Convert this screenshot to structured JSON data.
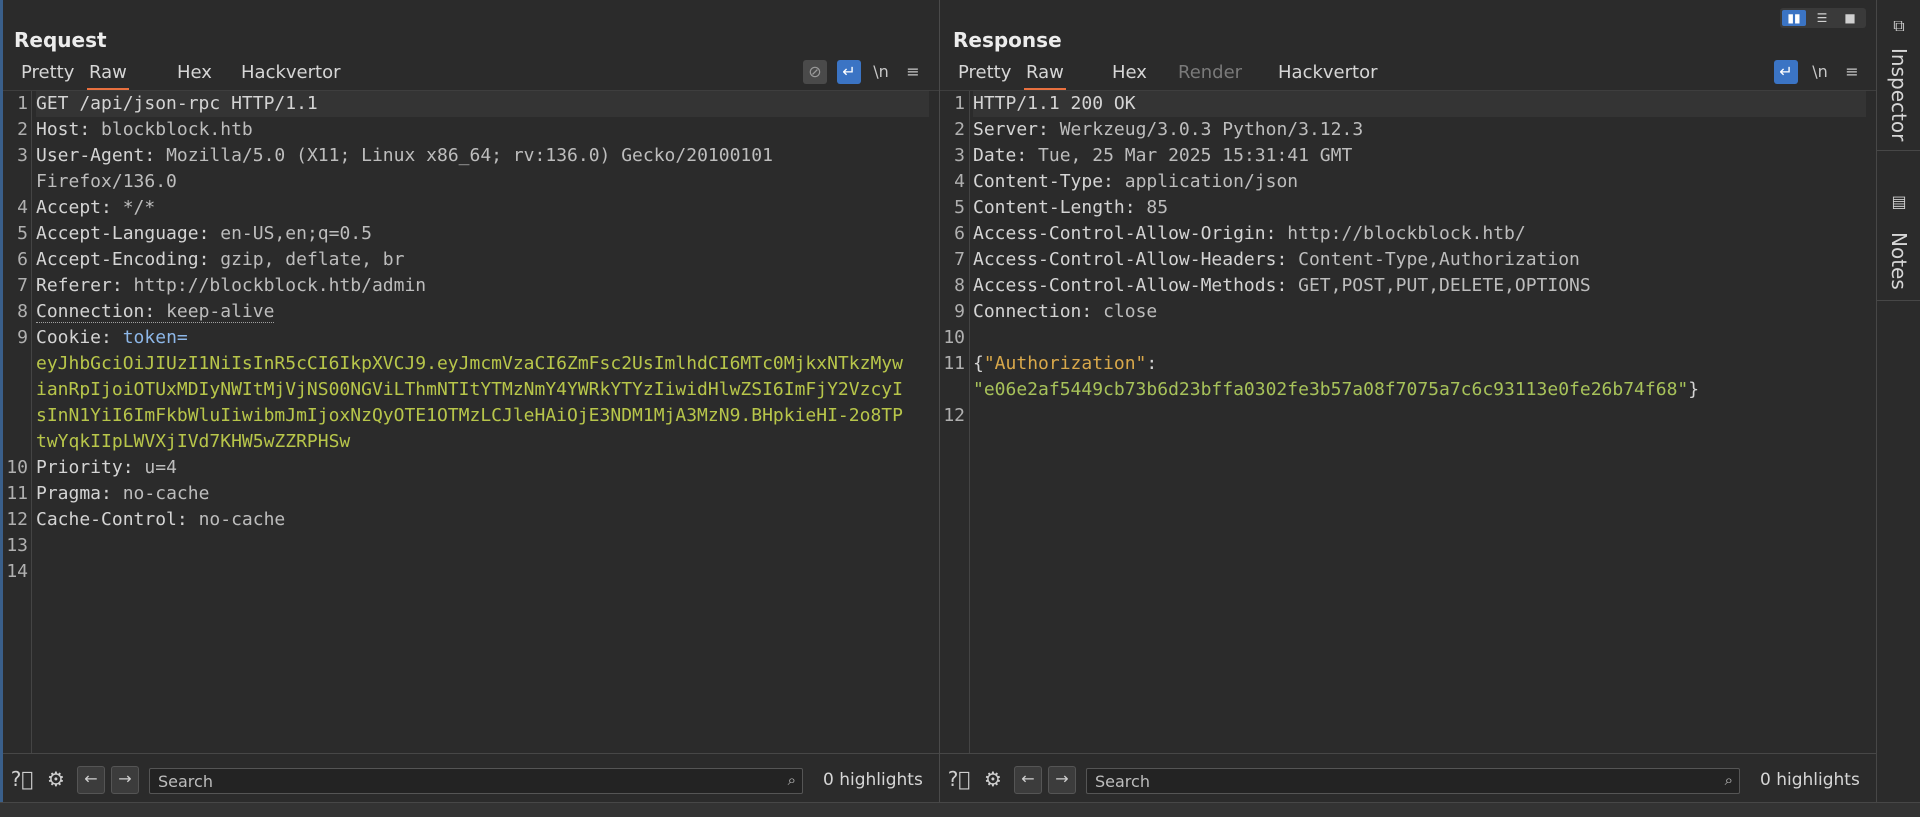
{
  "request": {
    "title": "Request",
    "tabs": [
      "Pretty",
      "Raw",
      "Hex",
      "Hackvertor"
    ],
    "active_tab": "Raw",
    "line_numbers": [
      "1",
      "2",
      "3",
      "4",
      "5",
      "6",
      "7",
      "8",
      "9",
      "10",
      "11",
      "12",
      "13",
      "14"
    ],
    "lines": {
      "l1": "GET /api/json-rpc HTTP/1.1",
      "l2k": "Host",
      "l2v": "blockblock.htb",
      "l3k": "User-Agent",
      "l3v": "Mozilla/5.0 (X11; Linux x86_64; rv:136.0) Gecko/20100101",
      "l3c": "Firefox/136.0",
      "l4k": "Accept",
      "l4v": "*/*",
      "l5k": "Accept-Language",
      "l5v": "en-US,en;q=0.5",
      "l6k": "Accept-Encoding",
      "l6v": "gzip, deflate, br",
      "l7k": "Referer",
      "l7v": "http://blockblock.htb/admin",
      "l8k": "Connection",
      "l8v": "keep-alive",
      "l9k": "Cookie",
      "l9name": "token=",
      "jwt1": "eyJhbGciOiJIUzI1NiIsInR5cCI6IkpXVCJ9.eyJmcmVzaCI6ZmFsc2UsImlhdCI6MTc0MjkxNTkzMyw",
      "jwt2": "ianRpIjoiOTUxMDIyNWItMjVjNS00NGViLThmNTItYTMzNmY4YWRkYTYzIiwidHlwZSI6ImFjY2VzcyI",
      "jwt3": "sInN1YiI6ImFkbWluIiwibmJmIjoxNzQyOTE1OTMzLCJleHAiOjE3NDM1MjA3MzN9.BHpkieHI-2o8TP",
      "jwt4": "twYqkIIpLWVXjIVd7KHW5wZZRPHSw",
      "l10k": "Priority",
      "l10v": "u=4",
      "l11k": "Pragma",
      "l11v": "no-cache",
      "l12k": "Cache-Control",
      "l12v": "no-cache"
    },
    "search_placeholder": "Search",
    "highlights": "0 highlights"
  },
  "response": {
    "title": "Response",
    "tabs": [
      "Pretty",
      "Raw",
      "Hex",
      "Render",
      "Hackvertor"
    ],
    "active_tab": "Raw",
    "disabled_tab": "Render",
    "line_numbers": [
      "1",
      "2",
      "3",
      "4",
      "5",
      "6",
      "7",
      "8",
      "9",
      "10",
      "11",
      "12"
    ],
    "lines": {
      "l1": "HTTP/1.1 200 OK",
      "l2k": "Server",
      "l2v": "Werkzeug/3.0.3 Python/3.12.3",
      "l3k": "Date",
      "l3v": "Tue, 25 Mar 2025 15:31:41 GMT",
      "l4k": "Content-Type",
      "l4v": "application/json",
      "l5k": "Content-Length",
      "l5v": "85",
      "l6k": "Access-Control-Allow-Origin",
      "l6v": "http://blockblock.htb/",
      "l7k": "Access-Control-Allow-Headers",
      "l7v": "Content-Type,Authorization",
      "l8k": "Access-Control-Allow-Methods",
      "l8v": "GET,POST,PUT,DELETE,OPTIONS",
      "l9k": "Connection",
      "l9v": "close",
      "json_open": "{",
      "json_key": "\"Authorization\"",
      "json_colon": ":",
      "json_value": "\"e06e2af5449cb73b6d23bffa0302fe3b57a08f7075a7c6c93113e0fe26b74f68\"",
      "json_close": "}"
    },
    "search_placeholder": "Search",
    "highlights": "0 highlights"
  },
  "sidebar": {
    "inspector_label": "Inspector",
    "notes_label": "Notes"
  },
  "toolbar_glyphs": {
    "newline": "\\n",
    "menu": "≡"
  },
  "colors": {
    "accent_tab": "#e8703f",
    "active_button": "#3b74c4",
    "jwt_text": "#b8c64a",
    "json_key": "#d9a84a",
    "json_string": "#a7c25a"
  }
}
